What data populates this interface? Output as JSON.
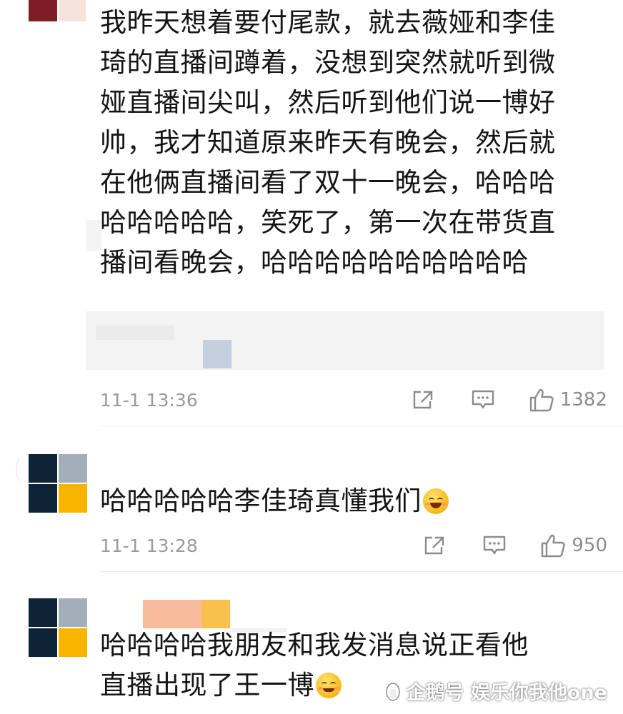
{
  "comments": [
    {
      "lines": [
        "我昨天想着要付尾款，就去薇娅和李佳",
        "琦的直播间蹲着，没想到突然就听到微",
        "娅直播间尖叫，然后听到他们说一博好",
        "帅，我才知道原来昨天有晚会，然后就",
        "在他俩直播间看了双十一晚会，哈哈哈",
        "哈哈哈哈哈，笑死了，第一次在带货直",
        "播间看晚会，哈哈哈哈哈哈哈哈哈哈"
      ],
      "time": "11-1 13:36",
      "likes": "1382"
    },
    {
      "lines": [
        "哈哈哈哈哈李佳琦真懂我们"
      ],
      "emoji": "grinning-face-emoji",
      "time": "11-1 13:28",
      "likes": "950"
    },
    {
      "lines": [
        "哈哈哈哈我朋友和我发消息说正看他",
        "直播出现了王一博"
      ],
      "emoji": "blushing-face-emoji"
    }
  ],
  "watermark": "企鹅号 娱乐你我他one",
  "icons": {
    "share": "share-icon",
    "reply": "comment-icon",
    "like": "thumbs-up-icon",
    "watermark": "penguin-icon"
  },
  "colors": {
    "text": "#141414",
    "meta": "#9a9a9a",
    "avatar_navy": "#0c2436",
    "avatar_gray": "#a2afb8",
    "avatar_yellow": "#f7b500",
    "avatar_maroon": "#7d1d28",
    "redacted_gray": "#f2f2f2",
    "redacted_blue": "#c5d0de",
    "redacted_peach": "#f8bb9c"
  }
}
